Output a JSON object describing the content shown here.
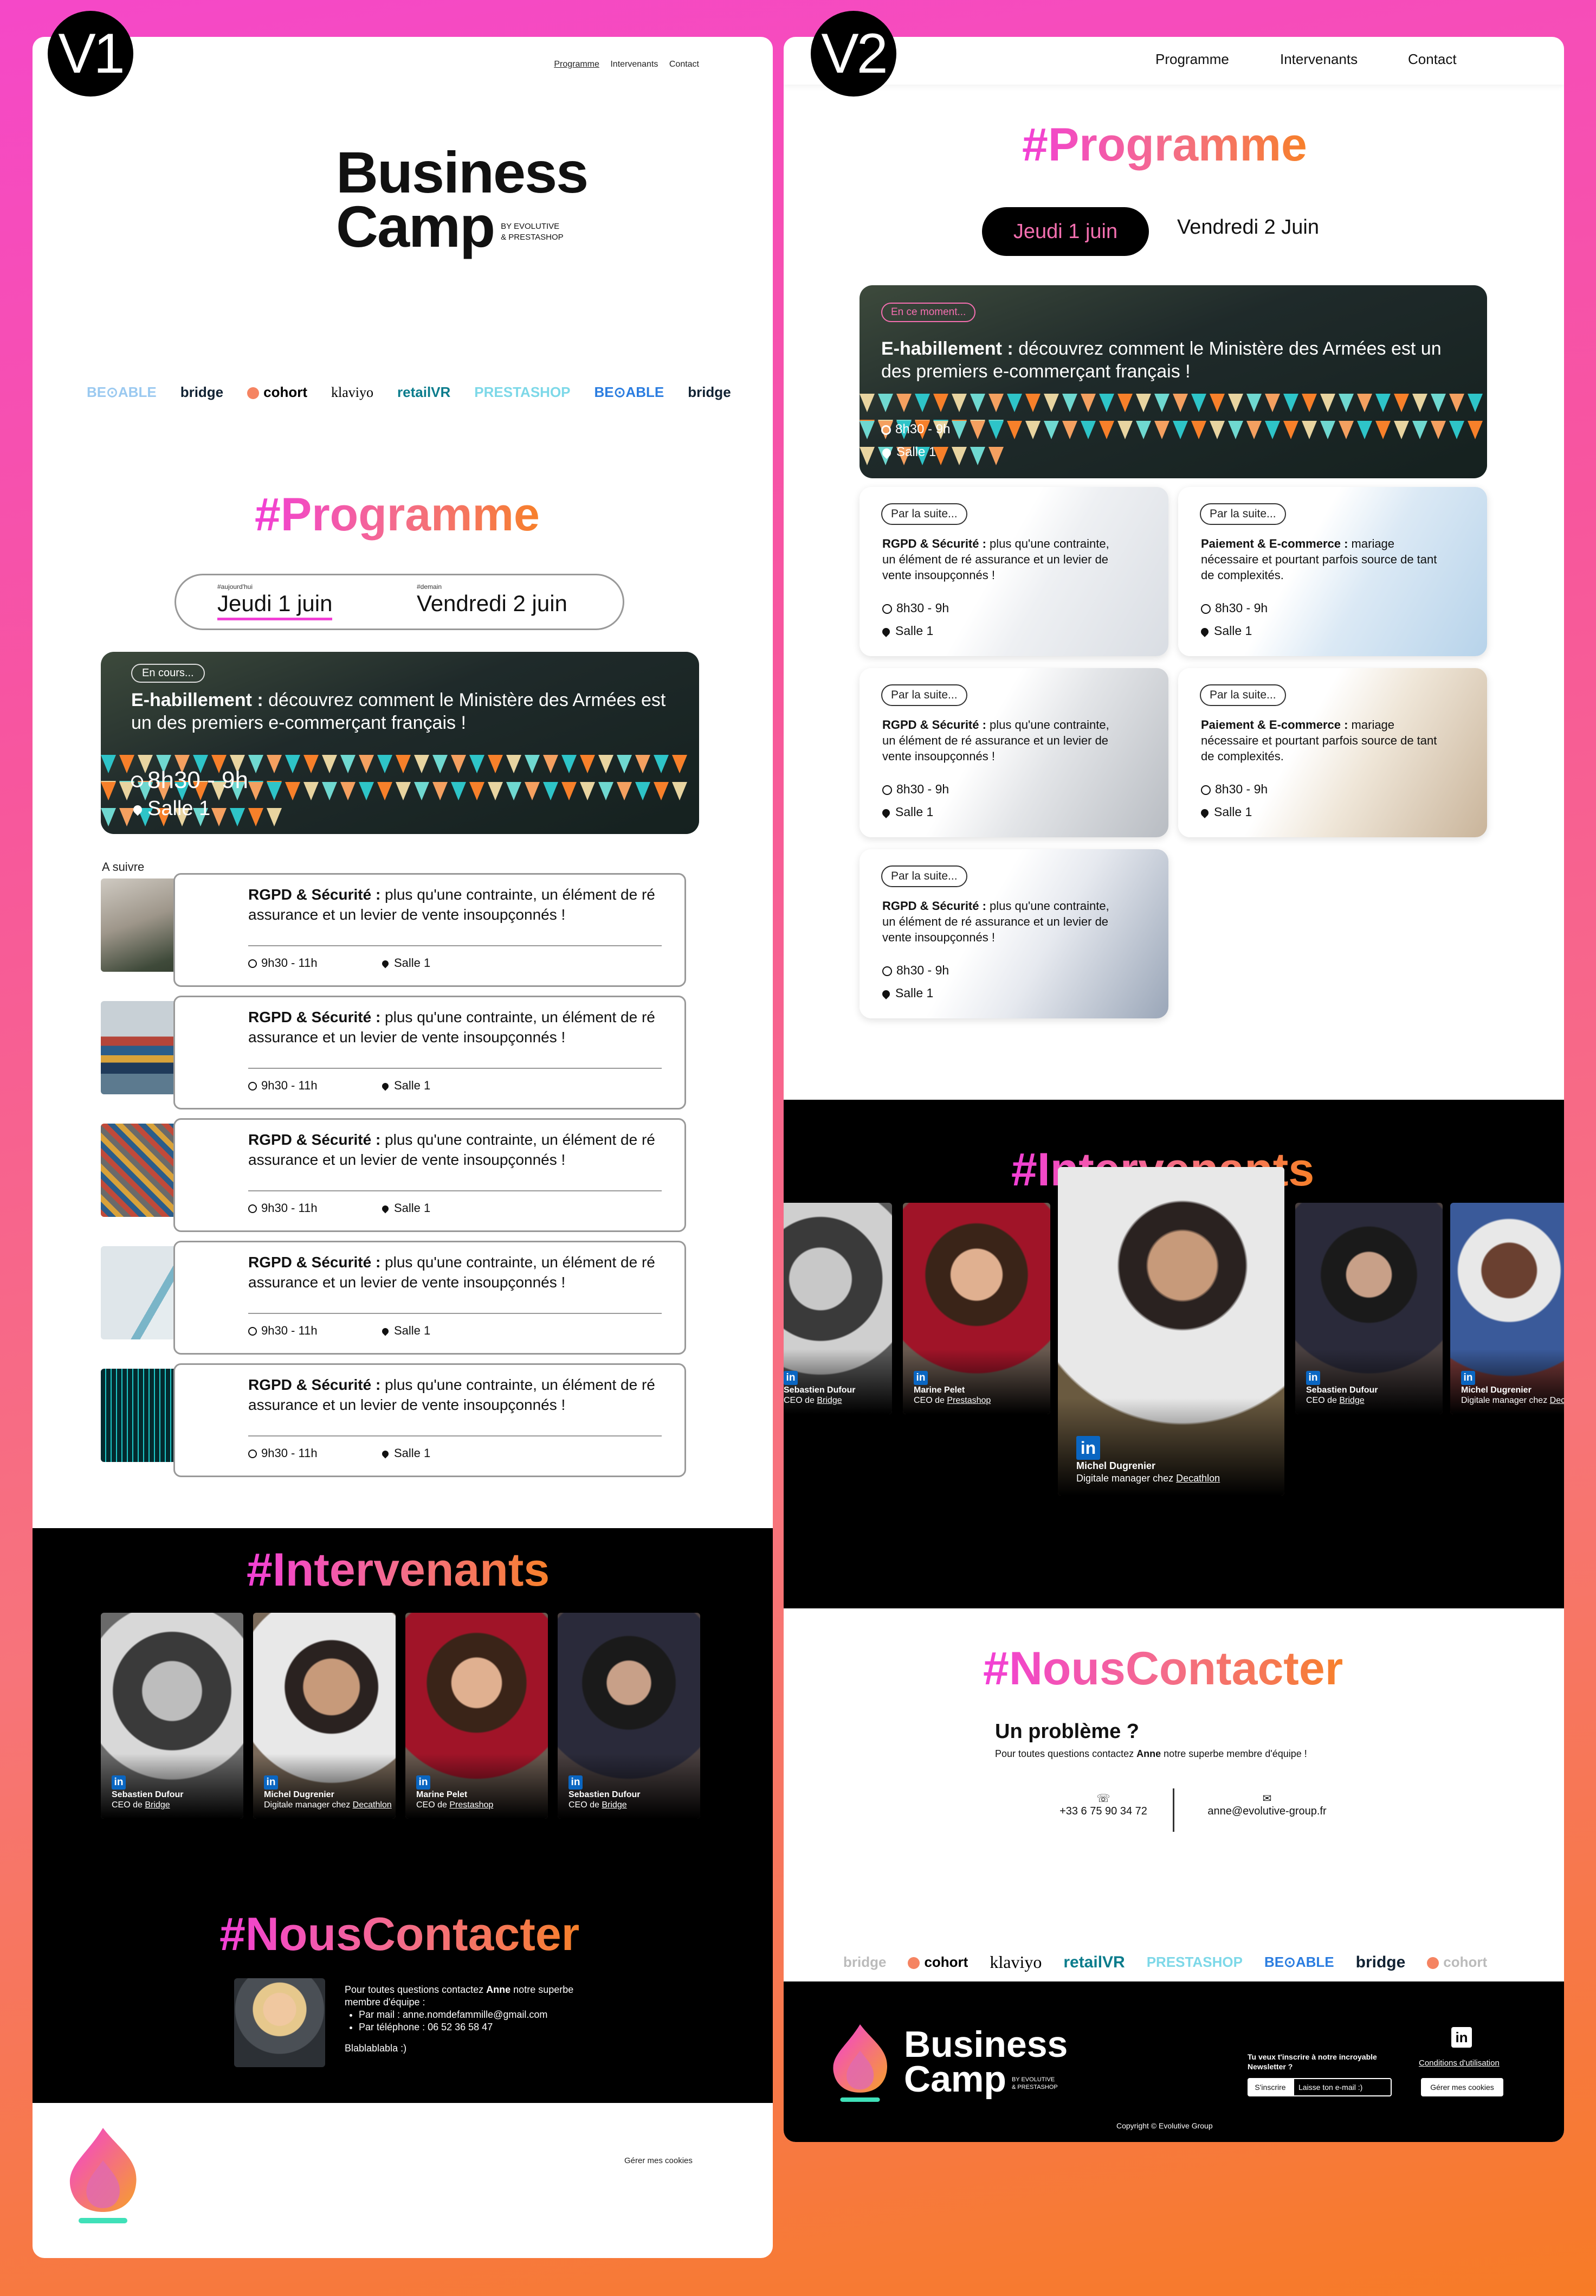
{
  "v1": {
    "badge": "V1",
    "nav": [
      "Programme",
      "Intervenants",
      "Contact"
    ],
    "brand": {
      "line1": "Business",
      "line2": "Camp",
      "by1": "BY EVOLUTIVE",
      "by2": "& PRESTASHOP"
    },
    "logos": [
      "BE⊙ABLE",
      "bridge",
      "cohort",
      "klaviyo",
      "retailVR",
      "PRESTASHOP",
      "BE⊙ABLE",
      "bridge",
      "cohort"
    ],
    "programme_title": "#Programme",
    "day_tabs": [
      {
        "tag": "#aujourd'hui",
        "label": "Jeudi 1 juin"
      },
      {
        "tag": "#demain",
        "label": "Vendredi 2 juin"
      }
    ],
    "hero": {
      "badge": "En cours...",
      "title_bold": "E-habillement :",
      "title_rest": " découvrez comment le Ministère des Armées est un des premiers e-commerçant français !",
      "time": "8h30 - 9h",
      "room": "Salle 1"
    },
    "next_label": "A suivre",
    "sessions": [
      {
        "bold": "RGPD & Sécurité :",
        "rest": " plus qu'une contrainte, un élément de ré assurance et un levier de vente insoupçonnés !",
        "time": "9h30 - 11h",
        "room": "Salle 1",
        "img": "statue"
      },
      {
        "bold": "RGPD & Sécurité :",
        "rest": " plus qu'une contrainte, un élément de ré assurance et un levier de vente insoupçonnés !",
        "time": "9h30 - 11h",
        "room": "Salle 1",
        "img": "ship"
      },
      {
        "bold": "RGPD & Sécurité :",
        "rest": " plus qu'une contrainte, un élément de ré assurance et un levier de vente insoupçonnés !",
        "time": "9h30 - 11h",
        "room": "Salle 1",
        "img": "containers"
      },
      {
        "bold": "RGPD & Sécurité :",
        "rest": " plus qu'une contrainte, un élément de ré assurance et un levier de vente insoupçonnés !",
        "time": "9h30 - 11h",
        "room": "Salle 1",
        "img": "server"
      },
      {
        "bold": "RGPD & Sécurité :",
        "rest": " plus qu'une contrainte, un élément de ré assurance et un levier de vente insoupçonnés !",
        "time": "9h30 - 11h",
        "room": "Salle 1",
        "img": "chip"
      }
    ],
    "intervenants_title": "#Intervenants",
    "speakers": [
      {
        "name": "Sebastien Dufour",
        "role": "CEO de ",
        "company": "Bridge"
      },
      {
        "name": "Michel Dugrenier",
        "role": "Digitale manager chez ",
        "company": "Decathlon"
      },
      {
        "name": "Marine Pelet",
        "role": "CEO de ",
        "company": "Prestashop"
      },
      {
        "name": "Sebastien Dufour",
        "role": "CEO de ",
        "company": "Bridge"
      }
    ],
    "contact_title": "#NousContacter",
    "contact": {
      "intro_a": "Pour toutes questions contactez ",
      "intro_name": "Anne",
      "intro_b": " notre superbe membre d'équipe :",
      "mail": "Par mail : anne.nomdefammille@gmail.com",
      "phone": "Par téléphone : 06 52 36 58 47",
      "extra": "Blablablabla :)"
    },
    "footer_link": "Gérer mes cookies"
  },
  "v2": {
    "badge": "V2",
    "nav": [
      "Programme",
      "Intervenants",
      "Contact"
    ],
    "programme_title": "#Programme",
    "day_tabs": [
      "Jeudi 1 juin",
      "Vendredi 2 Juin"
    ],
    "hero": {
      "badge": "En ce moment...",
      "title_bold": "E-habillement :",
      "title_rest": " découvrez comment le Ministère des Armées est un des premiers e-commerçant français !",
      "time": "8h30 - 9h",
      "room": "Salle 1"
    },
    "cards": [
      {
        "badge": "Par la suite...",
        "bold": "RGPD & Sécurité :",
        "rest": " plus qu'une contrainte, un élément de ré assurance et un levier de vente insoupçonnés !",
        "time": "8h30 - 9h",
        "room": "Salle 1",
        "bg": "hand"
      },
      {
        "badge": "Par la suite...",
        "bold": "Paiement & E-commerce :",
        "rest": " mariage nécessaire et pourtant parfois source de tant de complexités.",
        "time": "8h30 - 9h",
        "room": "Salle 1",
        "bg": "keyboard"
      },
      {
        "badge": "Par la suite...",
        "bold": "RGPD & Sécurité :",
        "rest": " plus qu'une contrainte, un élément de ré assurance et un levier de vente insoupçonnés !",
        "time": "8h30 - 9h",
        "room": "Salle 1",
        "bg": "paper"
      },
      {
        "badge": "Par la suite...",
        "bold": "Paiement & E-commerce :",
        "rest": " mariage nécessaire et pourtant parfois source de tant de complexités.",
        "time": "8h30 - 9h",
        "room": "Salle 1",
        "bg": "laptop"
      },
      {
        "badge": "Par la suite...",
        "bold": "RGPD & Sécurité :",
        "rest": " plus qu'une contrainte, un élément de ré assurance et un levier de vente insoupçonnés !",
        "time": "8h30 - 9h",
        "room": "Salle 1",
        "bg": "building"
      }
    ],
    "intervenants_title": "#Intervenants",
    "speakers": [
      {
        "name": "Sebastien Dufour",
        "role": "CEO de ",
        "company": "Bridge"
      },
      {
        "name": "Marine Pelet",
        "role": "CEO de ",
        "company": "Prestashop"
      },
      {
        "name": "Michel Dugrenier",
        "role": "Digitale manager chez ",
        "company": "Decathlon"
      },
      {
        "name": "Sebastien Dufour",
        "role": "CEO de ",
        "company": "Bridge"
      },
      {
        "name": "Michel Dugrenier",
        "role": "Digitale manager chez ",
        "company": "Decathlon"
      }
    ],
    "contact_title": "#NousContacter",
    "contact": {
      "heading": "Un problème ?",
      "intro_a": "Pour toutes questions contactez ",
      "intro_name": "Anne",
      "intro_b": " notre superbe membre d'équipe !",
      "phone": "+33 6 75 90 34 72",
      "email": "anne@evolutive-group.fr"
    },
    "logos": [
      "bridge",
      "cohort",
      "klaviyo",
      "retailVR",
      "PRESTASHOP",
      "BE⊙ABLE",
      "bridge",
      "cohort"
    ],
    "brand": {
      "line1": "Business",
      "line2": "Camp",
      "by1": "BY EVOLUTIVE",
      "by2": "& PRESTASHOP"
    },
    "newsletter": {
      "text": "Tu veux t'inscrire à notre incroyable Newsletter ?",
      "button": "S'inscrire",
      "placeholder": "Laisse ton e-mail :)"
    },
    "terms": "Conditions d'utilisation",
    "cookies": "Gérer mes cookies",
    "copyright": "Copyright © Evolutive Group"
  },
  "colors": {
    "pink": "#f23fd6",
    "orange": "#f7802a",
    "teal": "#2ec4c8",
    "linkedin": "#0a66c2"
  }
}
